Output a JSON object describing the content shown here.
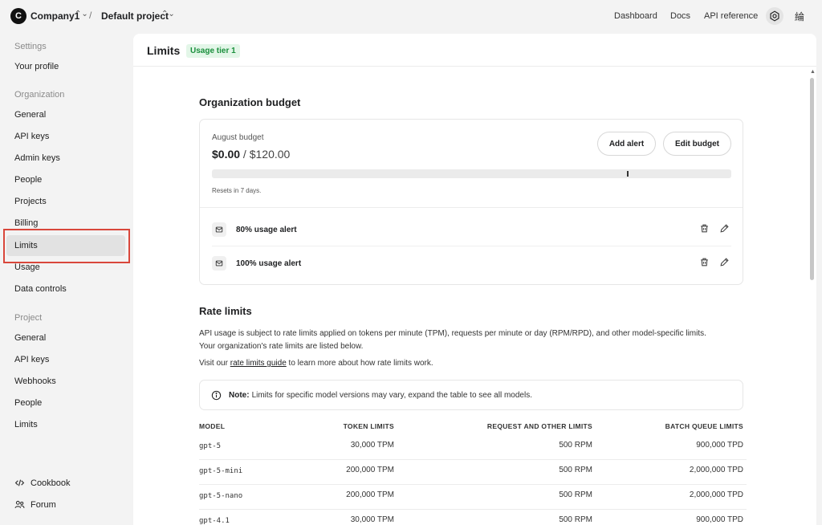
{
  "header": {
    "org_initial": "C",
    "org_name": "Company1",
    "separator": "/",
    "project_name": "Default project",
    "links": [
      "Dashboard",
      "Docs",
      "API reference"
    ],
    "lang_glyph": "綸"
  },
  "sidebar": {
    "settings_heading": "Settings",
    "your_profile": "Your profile",
    "organization_heading": "Organization",
    "org_items": [
      "General",
      "API keys",
      "Admin keys",
      "People",
      "Projects",
      "Billing",
      "Limits",
      "Usage",
      "Data controls"
    ],
    "project_heading": "Project",
    "project_items": [
      "General",
      "API keys",
      "Webhooks",
      "People",
      "Limits"
    ],
    "footer": [
      "Cookbook",
      "Forum"
    ]
  },
  "page": {
    "title": "Limits",
    "tier_badge": "Usage tier 1"
  },
  "budget": {
    "section_title": "Organization budget",
    "label": "August budget",
    "current": "$0.00",
    "separator": " / ",
    "max": "$120.00",
    "used_fraction": 0.0,
    "marker_fraction": 0.8,
    "add_alert": "Add alert",
    "edit_budget": "Edit budget",
    "resets": "Resets in 7 days.",
    "alerts": [
      "80% usage alert",
      "100% usage alert"
    ]
  },
  "rate_limits": {
    "section_title": "Rate limits",
    "desc_line1": "API usage is subject to rate limits applied on tokens per minute (TPM), requests per minute or day (RPM/RPD), and other model-specific limits.",
    "desc_line2": "Your organization's rate limits are listed below.",
    "visit_prefix": "Visit our ",
    "guide_link": "rate limits guide",
    "visit_suffix": " to learn more about how rate limits work.",
    "note_bold": "Note:",
    "note_text": "Limits for specific model versions may vary, expand the table to see all models.",
    "columns": [
      "MODEL",
      "TOKEN LIMITS",
      "REQUEST AND OTHER LIMITS",
      "BATCH QUEUE LIMITS"
    ],
    "rows": [
      {
        "model": "gpt-5",
        "token": "30,000 TPM",
        "request": "500 RPM",
        "batch": "900,000 TPD"
      },
      {
        "model": "gpt-5-mini",
        "token": "200,000 TPM",
        "request": "500 RPM",
        "batch": "2,000,000 TPD"
      },
      {
        "model": "gpt-5-nano",
        "token": "200,000 TPM",
        "request": "500 RPM",
        "batch": "2,000,000 TPD"
      },
      {
        "model": "gpt-4.1",
        "token": "30,000 TPM",
        "request": "500 RPM",
        "batch": "900,000 TPD"
      }
    ]
  }
}
